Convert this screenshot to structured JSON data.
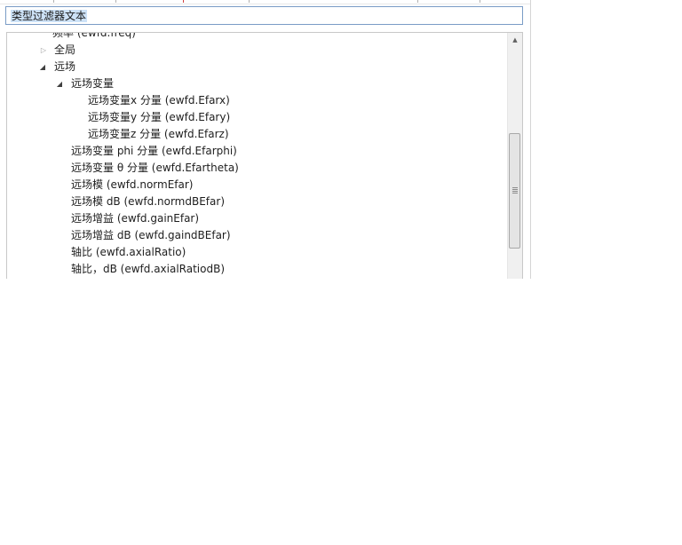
{
  "filter": {
    "text": "类型过滤器文本"
  },
  "tree": {
    "rows": [
      {
        "label": "频率 (ewfd.freq)"
      },
      {
        "label": "全局",
        "toggle": "▷"
      },
      {
        "label": "远场",
        "toggle": "◢"
      },
      {
        "label": "远场变量",
        "toggle": "◢"
      },
      {
        "label": "远场变量x 分量 (ewfd.Efarx)"
      },
      {
        "label": "远场变量y 分量 (ewfd.Efary)"
      },
      {
        "label": "远场变量z 分量 (ewfd.Efarz)"
      },
      {
        "label": "远场变量 phi 分量 (ewfd.Efarphi)"
      },
      {
        "label": "远场变量 θ 分量 (ewfd.Efartheta)"
      },
      {
        "label": "远场模 (ewfd.normEfar)"
      },
      {
        "label": "远场模 dB (ewfd.normdBEfar)"
      },
      {
        "label": "远场增益 (ewfd.gainEfar)"
      },
      {
        "label": "远场增益 dB (ewfd.gaindBEfar)"
      },
      {
        "label": "轴比 (ewfd.axialRatio)"
      },
      {
        "label": "轴比，dB (ewfd.axialRatiodB)"
      }
    ]
  },
  "scrollbar": {
    "up_arrow": "▲"
  }
}
